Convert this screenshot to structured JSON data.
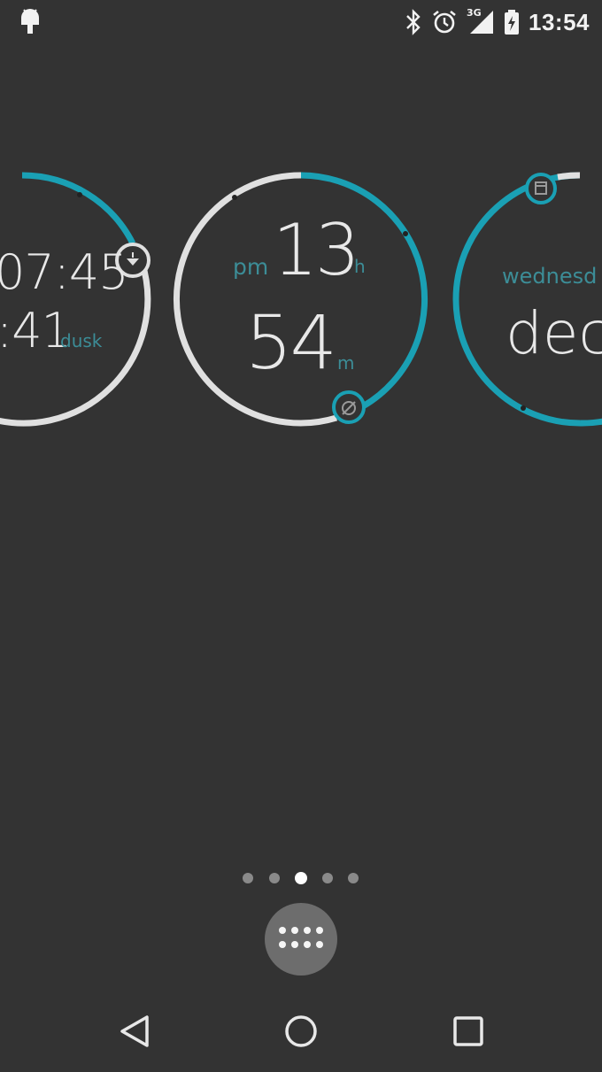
{
  "status_bar": {
    "time": "13:54",
    "network_label": "3G",
    "icons": [
      "android-notification-icon",
      "bluetooth-icon",
      "alarm-icon",
      "cellular-signal-icon",
      "battery-icon"
    ]
  },
  "widgets": {
    "sun": {
      "sunset_time": "07:45",
      "dusk_time": ":41",
      "dusk_label": "dusk",
      "icon": "sunset-icon"
    },
    "clock": {
      "ampm": "pm",
      "hour": "13",
      "hour_unit": "h",
      "minute": "54",
      "minute_unit": "m",
      "minute_progress": 0.9,
      "icon": "alarm-icon"
    },
    "date": {
      "weekday": "wednesd",
      "month": "dec",
      "icon": "calendar-icon"
    }
  },
  "home": {
    "page_count": 5,
    "active_page": 3,
    "app_drawer_icon": "app-drawer-icon"
  },
  "nav_bar": {
    "icons": [
      "back-icon",
      "home-icon",
      "recents-icon"
    ]
  },
  "colors": {
    "background": "#333333",
    "accent": "#1aa0b4",
    "ring_inactive": "#e0e0e0",
    "label_accent": "#3c8d97"
  }
}
